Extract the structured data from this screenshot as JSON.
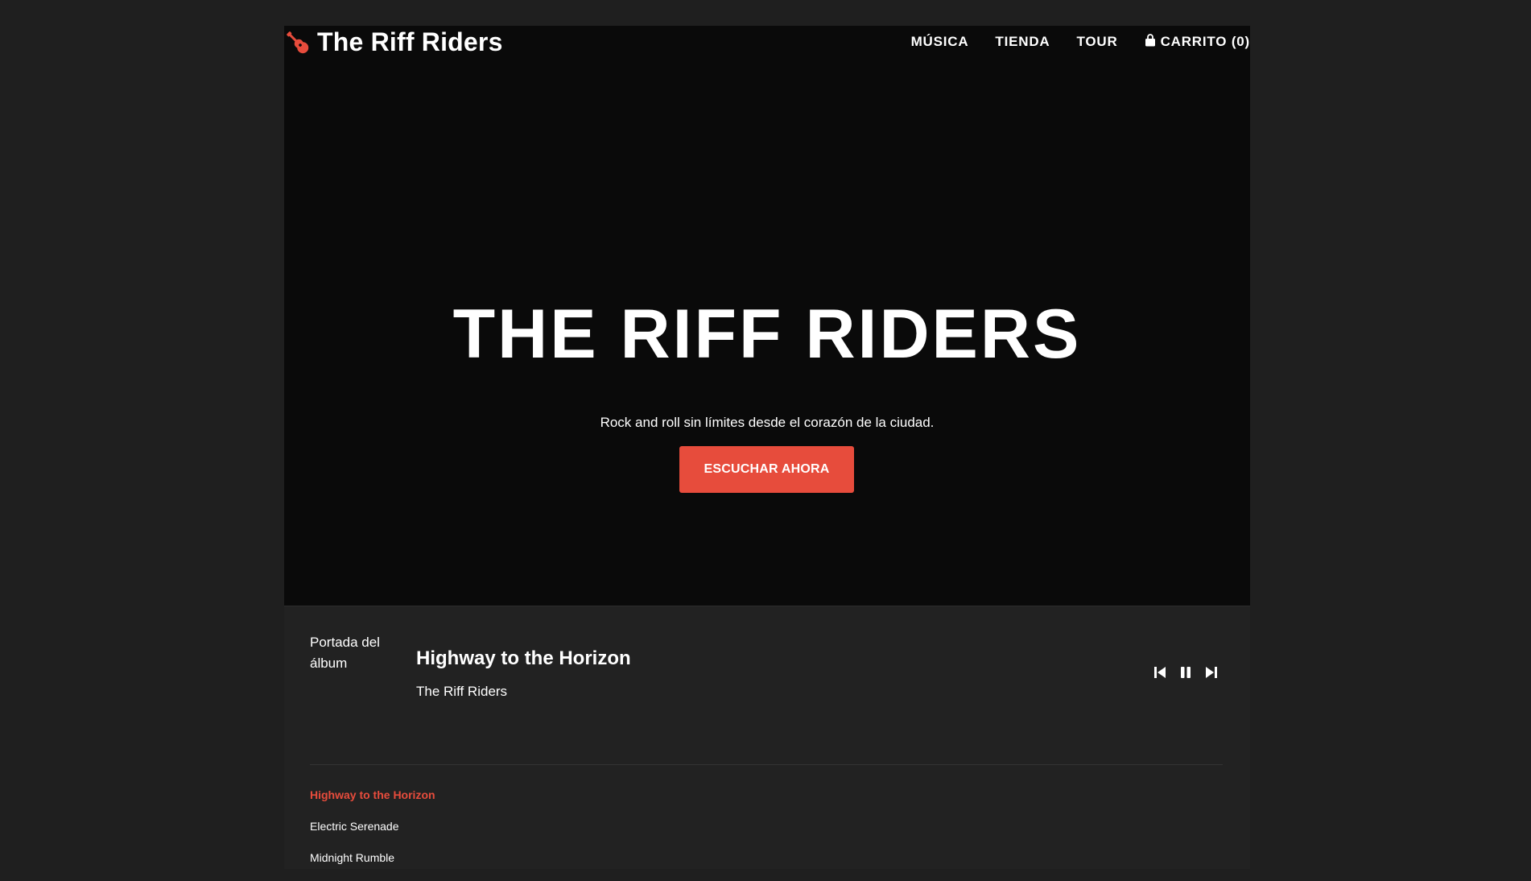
{
  "brand": {
    "name": "The Riff Riders",
    "logo_icon": "guitar-icon",
    "accent_color": "#e74c3c"
  },
  "nav": {
    "items": [
      {
        "label": "MÚSICA"
      },
      {
        "label": "TIENDA"
      },
      {
        "label": "TOUR"
      }
    ],
    "cart": {
      "icon": "shopping-bag-icon",
      "label": "CARRITO (0)"
    }
  },
  "hero": {
    "title": "THE RIFF RIDERS",
    "subtitle": "Rock and roll sin límites desde el corazón de la ciudad.",
    "cta_label": "ESCUCHAR AHORA"
  },
  "player": {
    "cover_alt": "Portada del álbum",
    "now_playing": {
      "title": "Highway to the Horizon",
      "artist": "The Riff Riders"
    },
    "controls": {
      "previous_icon": "skip-previous-icon",
      "pause_icon": "pause-icon",
      "next_icon": "skip-next-icon"
    },
    "playlist": [
      {
        "title": "Highway to the Horizon",
        "active": true
      },
      {
        "title": "Electric Serenade",
        "active": false
      },
      {
        "title": "Midnight Rumble",
        "active": false
      }
    ]
  }
}
